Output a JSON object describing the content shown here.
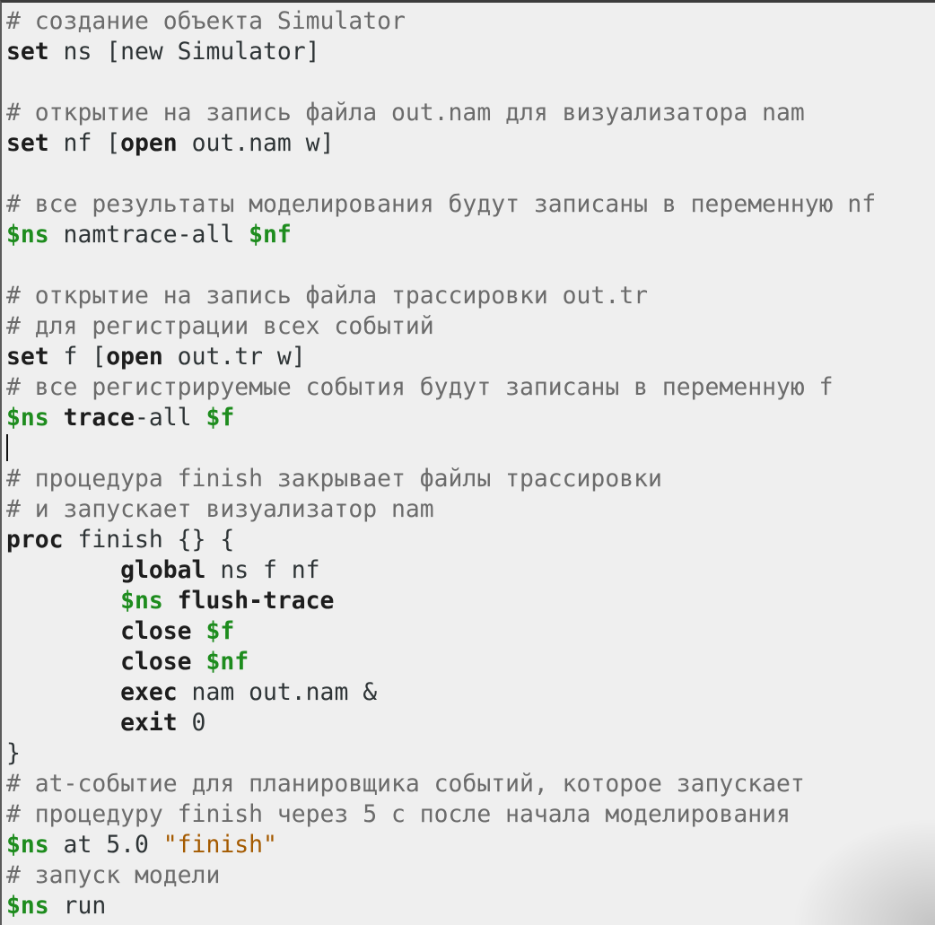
{
  "editor": {
    "lines": [
      [
        {
          "t": "c",
          "v": "# создание объекта Simulator"
        }
      ],
      [
        {
          "t": "k",
          "v": "set"
        },
        {
          "t": "p",
          "v": " ns [new Simulator]"
        }
      ],
      [],
      [
        {
          "t": "c",
          "v": "# открытие на запись файла out.nam для визуализатора nam"
        }
      ],
      [
        {
          "t": "k",
          "v": "set"
        },
        {
          "t": "p",
          "v": " nf ["
        },
        {
          "t": "k",
          "v": "open"
        },
        {
          "t": "p",
          "v": " out.nam w]"
        }
      ],
      [],
      [
        {
          "t": "c",
          "v": "# все результаты моделирования будут записаны в переменную nf"
        }
      ],
      [
        {
          "t": "v",
          "v": "$ns"
        },
        {
          "t": "p",
          "v": " namtrace-all "
        },
        {
          "t": "v",
          "v": "$nf"
        }
      ],
      [],
      [
        {
          "t": "c",
          "v": "# открытие на запись файла трассировки out.tr"
        }
      ],
      [
        {
          "t": "c",
          "v": "# для регистрации всех событий"
        }
      ],
      [
        {
          "t": "k",
          "v": "set"
        },
        {
          "t": "p",
          "v": " f ["
        },
        {
          "t": "k",
          "v": "open"
        },
        {
          "t": "p",
          "v": " out.tr w]"
        }
      ],
      [
        {
          "t": "c",
          "v": "# все регистрируемые события будут записаны в переменную f"
        }
      ],
      [
        {
          "t": "v",
          "v": "$ns"
        },
        {
          "t": "p",
          "v": " "
        },
        {
          "t": "k",
          "v": "trace"
        },
        {
          "t": "p",
          "v": "-all "
        },
        {
          "t": "v",
          "v": "$f"
        }
      ],
      [
        {
          "t": "cursor",
          "v": ""
        }
      ],
      [
        {
          "t": "c",
          "v": "# процедура finish закрывает файлы трассировки"
        }
      ],
      [
        {
          "t": "c",
          "v": "# и запускает визуализатор nam"
        }
      ],
      [
        {
          "t": "k",
          "v": "proc"
        },
        {
          "t": "p",
          "v": " finish {} {"
        }
      ],
      [
        {
          "t": "p",
          "v": "        "
        },
        {
          "t": "k",
          "v": "global"
        },
        {
          "t": "p",
          "v": " ns f nf"
        }
      ],
      [
        {
          "t": "p",
          "v": "        "
        },
        {
          "t": "v",
          "v": "$ns"
        },
        {
          "t": "p",
          "v": " "
        },
        {
          "t": "k",
          "v": "flush-trace"
        }
      ],
      [
        {
          "t": "p",
          "v": "        "
        },
        {
          "t": "k",
          "v": "close"
        },
        {
          "t": "p",
          "v": " "
        },
        {
          "t": "v",
          "v": "$f"
        }
      ],
      [
        {
          "t": "p",
          "v": "        "
        },
        {
          "t": "k",
          "v": "close"
        },
        {
          "t": "p",
          "v": " "
        },
        {
          "t": "v",
          "v": "$nf"
        }
      ],
      [
        {
          "t": "p",
          "v": "        "
        },
        {
          "t": "k",
          "v": "exec"
        },
        {
          "t": "p",
          "v": " nam out.nam &"
        }
      ],
      [
        {
          "t": "p",
          "v": "        "
        },
        {
          "t": "k",
          "v": "exit"
        },
        {
          "t": "p",
          "v": " 0"
        }
      ],
      [
        {
          "t": "p",
          "v": "}"
        }
      ],
      [
        {
          "t": "c",
          "v": "# at-событие для планировщика событий, которое запускает"
        }
      ],
      [
        {
          "t": "c",
          "v": "# процедуру finish через 5 с после начала моделирования"
        }
      ],
      [
        {
          "t": "v",
          "v": "$ns"
        },
        {
          "t": "p",
          "v": " at 5.0 "
        },
        {
          "t": "s",
          "v": "\"finish\""
        }
      ],
      [
        {
          "t": "c",
          "v": "# запуск модели"
        }
      ],
      [
        {
          "t": "v",
          "v": "$ns"
        },
        {
          "t": "p",
          "v": " run"
        }
      ]
    ]
  },
  "colors": {
    "background": "#efefef",
    "comment": "#6b6b6b",
    "keyword": "#1d1d1d",
    "variable": "#1e8c1e",
    "string": "#a45a00",
    "plain": "#2e3436"
  }
}
